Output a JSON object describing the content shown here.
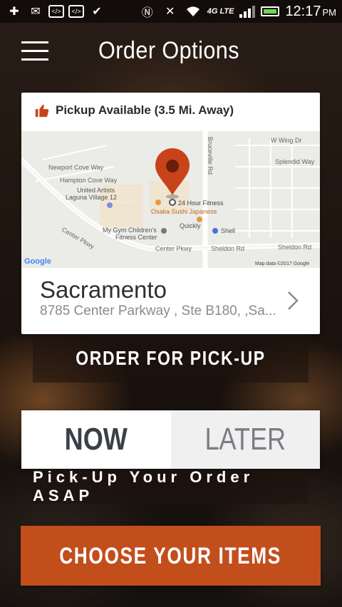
{
  "status_bar": {
    "time": "12:17",
    "ampm": "PM",
    "network": "4G LTE",
    "icons": [
      "plus-icon",
      "mail-icon",
      "code-icon",
      "code-icon",
      "check-icon",
      "nfc-icon",
      "mute-icon",
      "wifi-icon",
      "signal-icon",
      "battery-icon"
    ]
  },
  "header": {
    "title": "Order Options"
  },
  "store_card": {
    "pickup_label": "Pickup Available (3.5 Mi. Away)",
    "location_name": "Sacramento",
    "address": "8785 Center Parkway , Ste B180, ,Sa...",
    "map": {
      "labels": {
        "bruceville": "Bruceville Rd",
        "wwing": "W Wing Dr",
        "splendid": "Splendid Way",
        "newport": "Newport Cove Way",
        "hampton": "Hampton Cove Way",
        "ua1": "United Artists",
        "ua2": "Laguna Village 12",
        "fitness": "24 Hour Fitness",
        "osaka": "Osaka Sushi Japanese",
        "quickly": "Quickly",
        "shell": "Shell",
        "centerpkwy_left": "Center Pkwy",
        "mygym1": "My Gym Children's",
        "mygym2": "Fitness Center",
        "centerpkwy": "Center Pkwy",
        "sheldon1": "Sheldon Rd",
        "sheldon2": "Sheldon Rd",
        "google": "Google",
        "mapdata": "Map data ©2017 Google"
      }
    }
  },
  "buttons": {
    "order_pickup": "ORDER FOR PICK-UP",
    "now": "NOW",
    "later": "LATER",
    "asap": "Pick-Up Your Order ASAP",
    "choose_items": "CHOOSE YOUR ITEMS"
  },
  "colors": {
    "accent": "#c24e1c",
    "pin": "#c9431a"
  }
}
